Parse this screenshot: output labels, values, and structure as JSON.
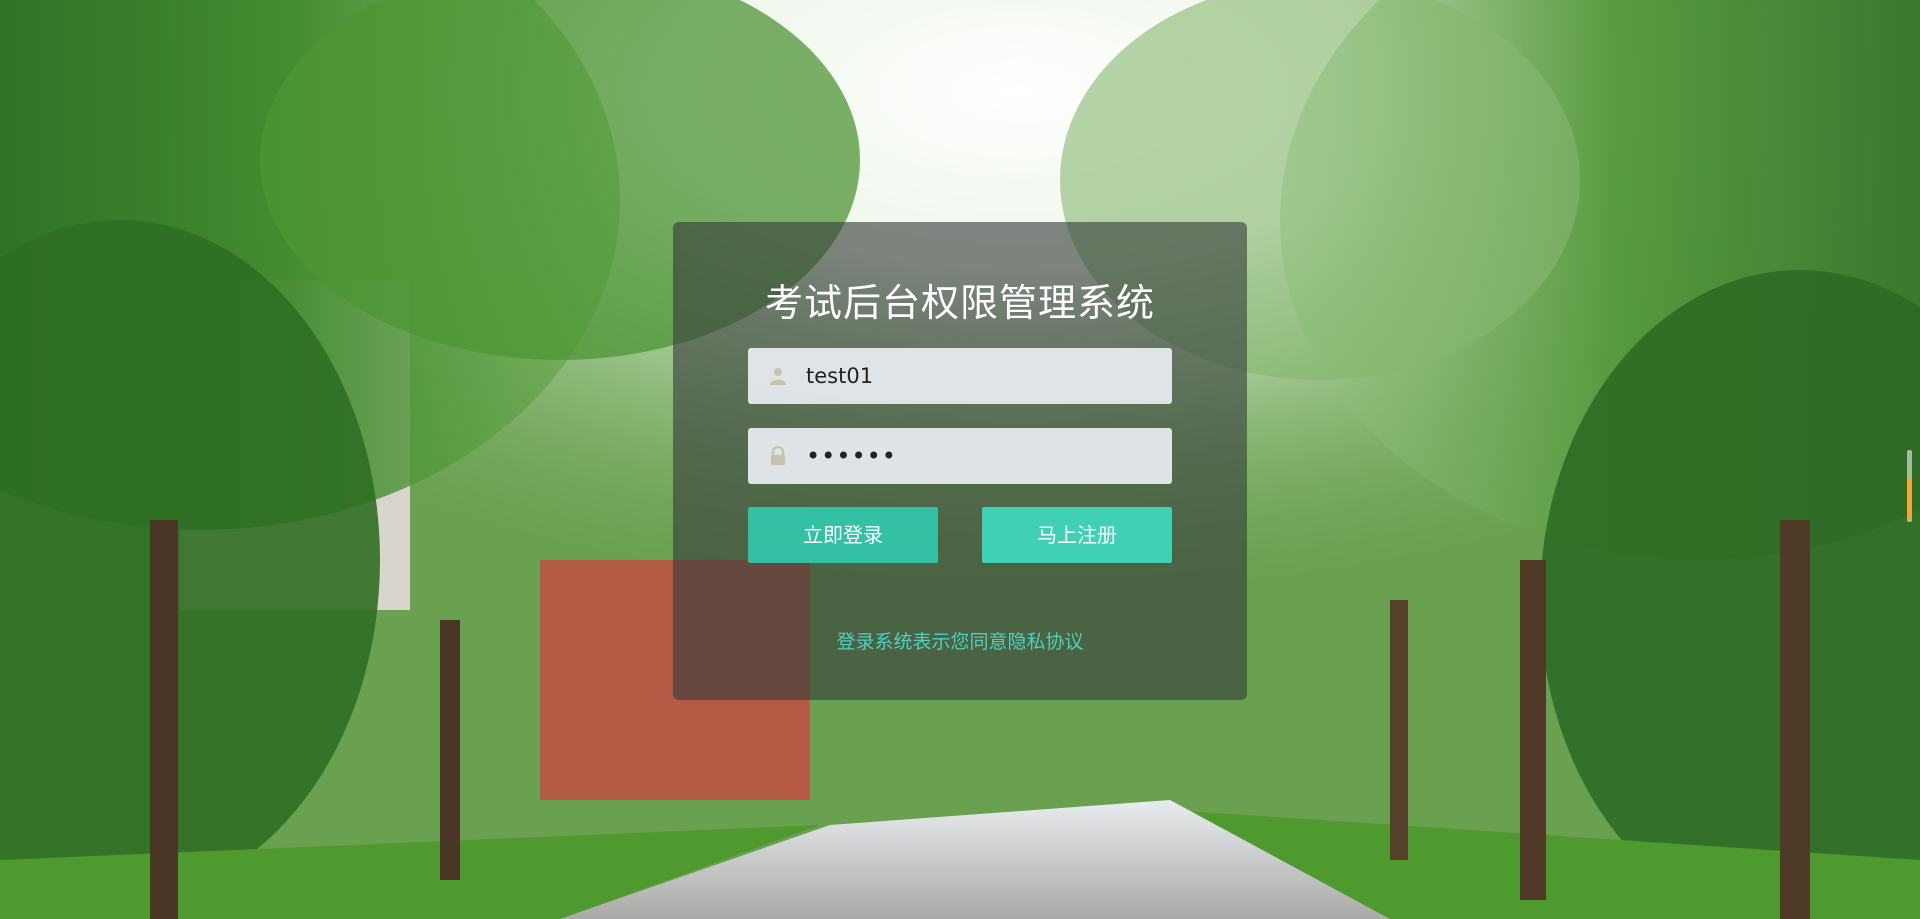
{
  "login": {
    "title": "考试后台权限管理系统",
    "username": {
      "value": "test01",
      "icon": "user-icon"
    },
    "password": {
      "value": "••••••",
      "icon": "lock-icon"
    },
    "login_button": "立即登录",
    "register_button": "马上注册",
    "privacy_link": "登录系统表示您同意隐私协议"
  },
  "colors": {
    "accent": "#35c3a6",
    "link": "#4fd0c0",
    "card_overlay": "#373e3a"
  },
  "background": {
    "scene": "tree-lined-campus-road"
  }
}
